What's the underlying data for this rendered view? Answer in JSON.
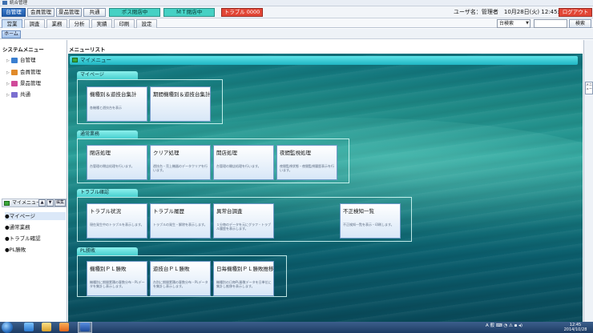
{
  "window": {
    "title": "統合管理"
  },
  "menu": {
    "buttons": [
      {
        "label": "台管理",
        "active": true
      },
      {
        "label": "会員管理",
        "active": false
      },
      {
        "label": "景品管理",
        "active": false
      },
      {
        "label": "共通",
        "active": false
      }
    ],
    "status1": "ポス閉店中",
    "status2": "ＭＴ閉店中",
    "trouble": "トラブル 0000",
    "user_info": "ユーザ名：管理者　10月28日(火) 12:45:07",
    "logout": "ログアウト"
  },
  "tabs": [
    "営業",
    "調査",
    "業務",
    "分析",
    "実績",
    "印刷",
    "設定"
  ],
  "search": {
    "combo_value": "台検索",
    "button": "検索"
  },
  "breadcrumb": {
    "home": "ホーム"
  },
  "sidebar": {
    "title": "システムメニュー",
    "items": [
      {
        "label": "台管理",
        "icon": "slot-machine-icon",
        "color": "#3a7fd0"
      },
      {
        "label": "会員管理",
        "icon": "members-icon",
        "color": "#e08a2a"
      },
      {
        "label": "景品管理",
        "icon": "prize-icon",
        "color": "#d04a9a"
      },
      {
        "label": "共通",
        "icon": "common-icon",
        "color": "#7b6fd0"
      }
    ]
  },
  "mymenu": {
    "title": "マイメニュー",
    "edit": "編集",
    "items": [
      "●マイページ",
      "●通常業務",
      "●トラブル確認",
      "●PL勝敗"
    ]
  },
  "main": {
    "title": "メニューリスト",
    "page_bar": "マイメニュー",
    "right_strip": "メニュー",
    "sections": [
      {
        "label": "マイページ",
        "cards": [
          {
            "title": "機種別＆遊技台集計",
            "desc": "各機種と遊技台を表示"
          },
          {
            "title": "期間機種別＆遊技台集計",
            "desc": ""
          }
        ]
      },
      {
        "label": "通常業務",
        "cards": [
          {
            "title": "閉店処理",
            "desc": "台管理の閉店処理を行います。"
          },
          {
            "title": "クリア処理",
            "desc": "遊技台・売上機器のデータクリアを行います。"
          },
          {
            "title": "開店処理",
            "desc": "台管理の開店処理を行います。"
          },
          {
            "title": "夜間監視処理",
            "desc": "夜間監視状態・夜間監視履歴表示を行います。"
          }
        ]
      },
      {
        "label": "トラブル確認",
        "cards": [
          {
            "title": "トラブル状況",
            "desc": "現在発生中のトラブルを表示します。"
          },
          {
            "title": "トラブル履歴",
            "desc": "トラブルの発生・解除を表示します。"
          },
          {
            "title": "異常台調査",
            "desc": "１分毎のデータを元にグラフ・トラブル履歴を表示します。"
          },
          {
            "title": "不正検知一覧",
            "desc": "不正検知一覧を表示・印刷します。"
          }
        ]
      },
      {
        "label": "PL勝敗",
        "cards": [
          {
            "title": "機種別ＰＬ勝敗",
            "desc": "機種別に期間累積の客数分布・PLデータを集計し表示します。"
          },
          {
            "title": "遊技台ＰＬ勝敗",
            "desc": "台別に期間累積の客数分布・PLデータを集計し表示します。"
          },
          {
            "title": "日毎機種別ＰＬ勝敗推移",
            "desc": "機種別の日毎PL勝敗データを日単位に集計し推移を表示します。"
          }
        ]
      }
    ]
  },
  "taskbar": {
    "tray": "A 般 ⌨ ◔ ⚠ ▪ ◂)",
    "time": "12:45",
    "date": "2014/10/28"
  }
}
